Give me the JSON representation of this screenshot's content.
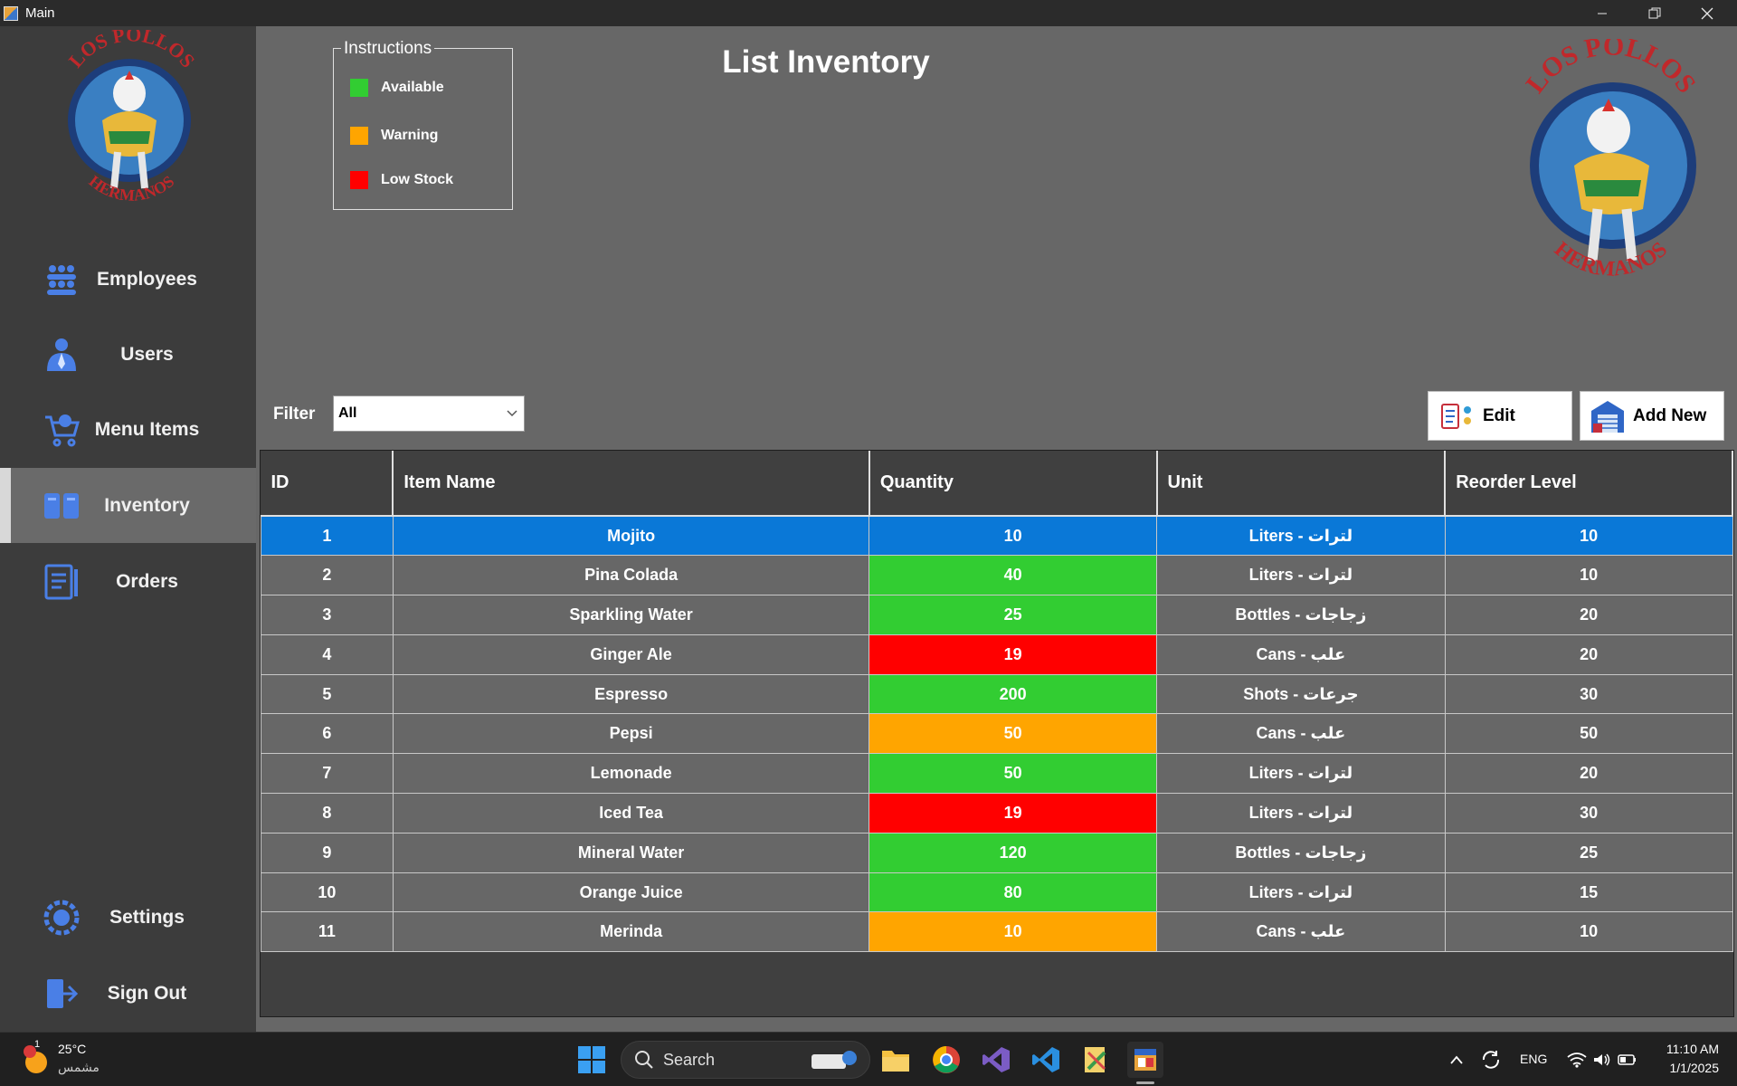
{
  "window": {
    "title": "Main"
  },
  "sidebar": {
    "logo": {
      "top_text": "LOS POLLOS",
      "bottom_text": "HERMANOS"
    },
    "items": [
      {
        "label": "Employees",
        "icon": "employees-icon"
      },
      {
        "label": "Users",
        "icon": "users-icon"
      },
      {
        "label": "Menu Items",
        "icon": "menu-items-icon"
      },
      {
        "label": "Inventory",
        "icon": "inventory-icon",
        "active": true
      },
      {
        "label": "Orders",
        "icon": "orders-icon"
      },
      {
        "label": "Settings",
        "icon": "settings-icon"
      },
      {
        "label": "Sign Out",
        "icon": "sign-out-icon"
      }
    ]
  },
  "main": {
    "title": "List Inventory",
    "instructions": {
      "title": "Instructions",
      "items": [
        {
          "label": "Available",
          "color": "#32CD32"
        },
        {
          "label": "Warning",
          "color": "#FFA500"
        },
        {
          "label": "Low Stock",
          "color": "#FF0000"
        }
      ]
    },
    "filter": {
      "label": "Filter",
      "value": "All"
    },
    "buttons": {
      "edit": "Edit",
      "add_new": "Add New"
    },
    "table": {
      "columns": [
        "ID",
        "Item Name",
        "Quantity",
        "Unit",
        "Reorder Level"
      ],
      "rows": [
        {
          "id": "1",
          "name": "Mojito",
          "quantity": "10",
          "unit": "Liters - لترات",
          "reorder": "10",
          "status": "selected"
        },
        {
          "id": "2",
          "name": "Pina Colada",
          "quantity": "40",
          "unit": "Liters - لترات",
          "reorder": "10",
          "status": "ok"
        },
        {
          "id": "3",
          "name": "Sparkling Water",
          "quantity": "25",
          "unit": "Bottles - زجاجات",
          "reorder": "20",
          "status": "ok"
        },
        {
          "id": "4",
          "name": "Ginger Ale",
          "quantity": "19",
          "unit": "Cans - علب",
          "reorder": "20",
          "status": "low"
        },
        {
          "id": "5",
          "name": "Espresso",
          "quantity": "200",
          "unit": "Shots - جرعات",
          "reorder": "30",
          "status": "ok"
        },
        {
          "id": "6",
          "name": "Pepsi",
          "quantity": "50",
          "unit": "Cans - علب",
          "reorder": "50",
          "status": "warn"
        },
        {
          "id": "7",
          "name": "Lemonade",
          "quantity": "50",
          "unit": "Liters - لترات",
          "reorder": "20",
          "status": "ok"
        },
        {
          "id": "8",
          "name": "Iced Tea",
          "quantity": "19",
          "unit": "Liters - لترات",
          "reorder": "30",
          "status": "low"
        },
        {
          "id": "9",
          "name": "Mineral Water",
          "quantity": "120",
          "unit": "Bottles - زجاجات",
          "reorder": "25",
          "status": "ok"
        },
        {
          "id": "10",
          "name": "Orange Juice",
          "quantity": "80",
          "unit": "Liters - لترات",
          "reorder": "15",
          "status": "ok"
        },
        {
          "id": "11",
          "name": "Merinda",
          "quantity": "10",
          "unit": "Cans - علب",
          "reorder": "10",
          "status": "warn"
        }
      ]
    }
  },
  "taskbar": {
    "weather": {
      "temp": "25°C",
      "condition": "مشمس",
      "badge": "1"
    },
    "search_placeholder": "Search",
    "language": "ENG",
    "time": "11:10 AM",
    "date": "1/1/2025"
  }
}
